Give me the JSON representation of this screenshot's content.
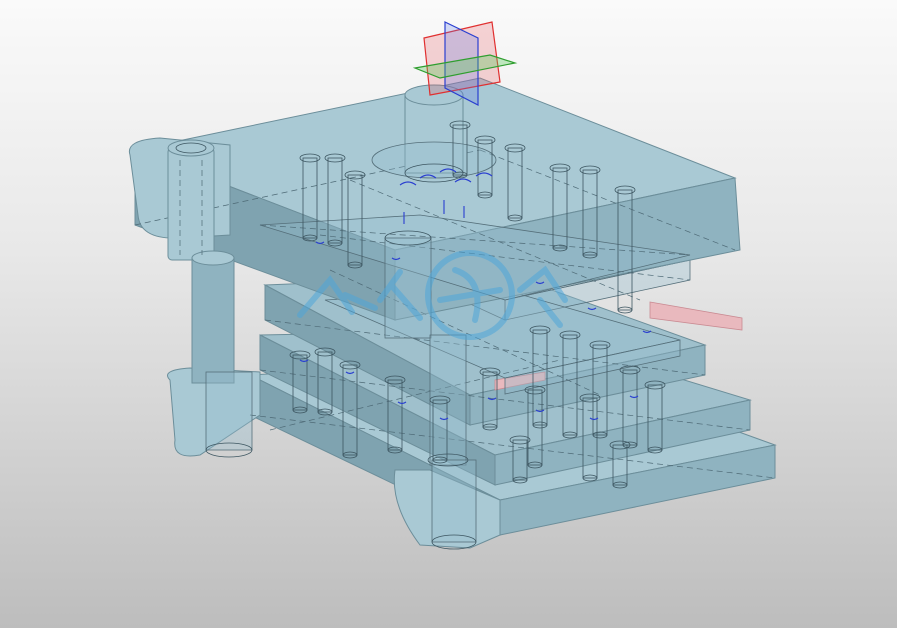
{
  "scene": {
    "background_top": "#fafafa",
    "background_bottom": "#bdbdbd",
    "model_color": "#8fb3c0",
    "strip_color": "#e9b9be",
    "hidden_line_color": "#4e6a76",
    "highlight_line_color": "#2a3fd0"
  },
  "triad": {
    "x_plane_color": "#e03030",
    "y_plane_color": "#2f9e2f",
    "z_plane_color": "#2a3fd0"
  },
  "watermark": {
    "color": "#4ea6d8"
  }
}
